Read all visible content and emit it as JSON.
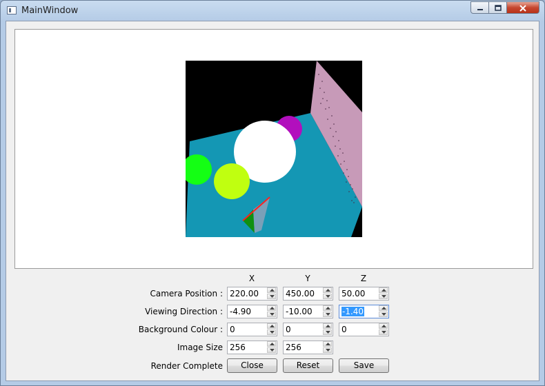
{
  "window": {
    "title": "MainWindow",
    "icon": "app-window-icon",
    "min_icon": "minimize-icon",
    "max_icon": "maximize-icon",
    "close_icon": "close-icon"
  },
  "axes": {
    "x": "X",
    "y": "Y",
    "z": "Z"
  },
  "rows": {
    "camera_position": {
      "label": "Camera Position :",
      "x": "220.00",
      "y": "450.00",
      "z": "50.00"
    },
    "viewing_direction": {
      "label": "Viewing Direction :",
      "x": "-4.90",
      "y": "-10.00",
      "z": "-1.40"
    },
    "background_colour": {
      "label": "Background Colour :",
      "x": "0",
      "y": "0",
      "z": "0"
    },
    "image_size": {
      "label": "Image Size",
      "x": "256",
      "y": "256"
    }
  },
  "status": {
    "text": "Render Complete"
  },
  "buttons": {
    "close": "Close",
    "reset": "Reset",
    "save": "Save"
  },
  "colors": {
    "background": "#000000",
    "floor": "#1497b4",
    "wall": "#c79ab8",
    "white_sphere": "#ffffff",
    "magenta_sphere": "#b20fbd",
    "green_sphere": "#14ff14",
    "lime_sphere": "#c0ff10",
    "cone_red": "#ff2020",
    "cone_green": "#109010",
    "cone_grey": "#7aa0b8"
  }
}
